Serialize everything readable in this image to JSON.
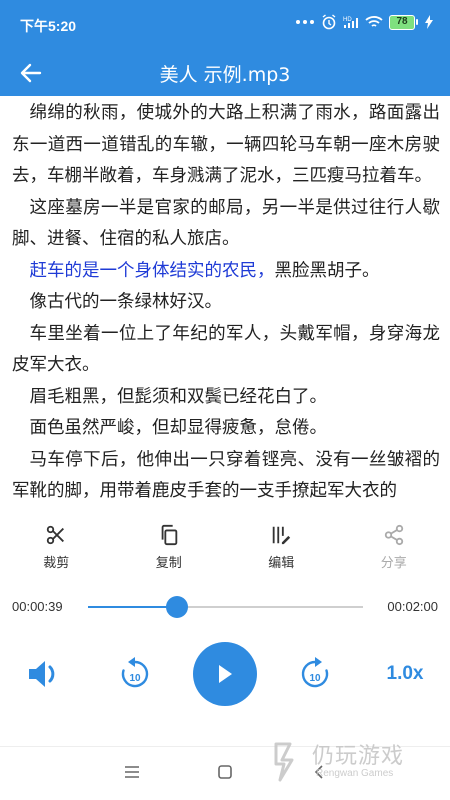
{
  "status_bar": {
    "time": "下午5:20",
    "battery": "78"
  },
  "app_bar": {
    "title": "美人 示例.mp3"
  },
  "content": {
    "paragraphs": [
      "绵绵的秋雨，使城外的大路上积满了雨水，路面露出东一道西一道错乱的车辙，一辆四轮马车朝一座木房驶去，车棚半敞着，车身溅满了泥水，三匹瘦马拉着车。",
      "这座墓房一半是官家的邮局，另一半是供过往行人歇脚、进餐、住宿的私人旅店。",
      "像古代的一条绿林好汉。",
      "车里坐着一位上了年纪的军人，头戴军帽，身穿海龙皮军大衣。",
      "眉毛粗黑，但髭须和双鬓已经花白了。",
      "面色虽然严峻，但却显得疲惫，怠倦。",
      "马车停下后，他伸出一只穿着铿亮、没有一丝皱褶的军靴的脚，用带着鹿皮手套的一支手撩起军大衣的"
    ],
    "active_highlight": "赶车的是一个身体结实的农民，",
    "active_rest": "黑脸黑胡子。"
  },
  "toolbar": {
    "cut_label": "裁剪",
    "copy_label": "复制",
    "edit_label": "编辑",
    "share_label": "分享"
  },
  "player": {
    "current_time": "00:00:39",
    "total_time": "00:02:00",
    "progress": 0.325,
    "rewind_seconds": "10",
    "forward_seconds": "10",
    "speed": "1.0x"
  },
  "watermark": {
    "text": "仍玩游戏",
    "sub": "Rengwan Games"
  },
  "colors": {
    "primary": "#2f8be0",
    "highlight_text": "#1f3bd6"
  }
}
